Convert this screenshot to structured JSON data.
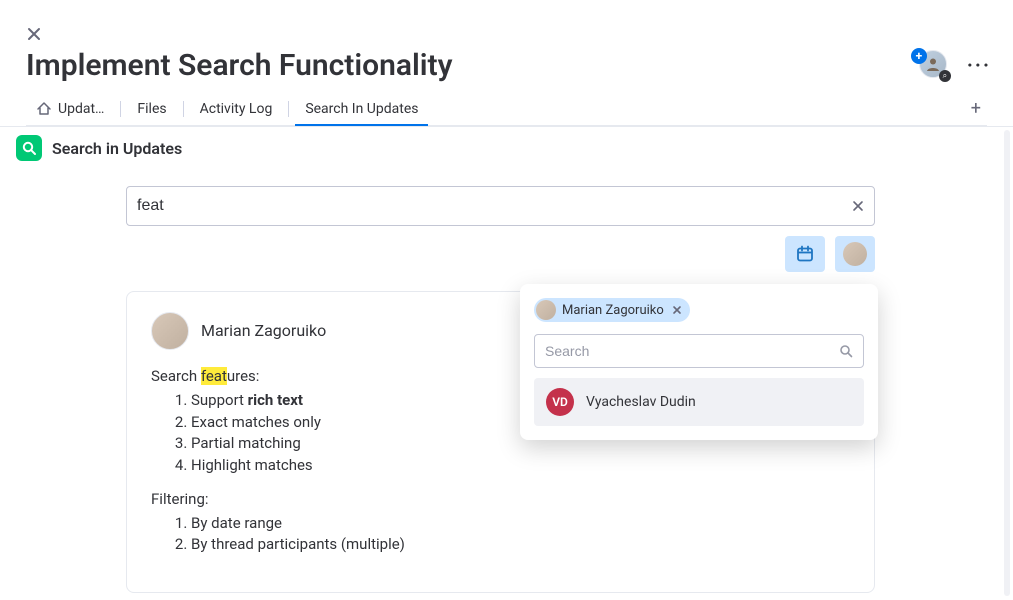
{
  "title": "Implement Search Functionality",
  "tabs": {
    "updates": "Updat…",
    "files": "Files",
    "activity_log": "Activity Log",
    "search_in_updates": "Search In Updates"
  },
  "subheader_title": "Search in Updates",
  "search_value": "feat",
  "update": {
    "author": "Marian Zagoruiko",
    "line1_pre": "Search ",
    "line1_hl": "feat",
    "line1_post": "ures:",
    "features": {
      "i1_pre": "Support ",
      "i1_bold": "rich text",
      "i2": "Exact matches only",
      "i3": "Partial matching",
      "i4": "Highlight matches"
    },
    "filtering_label": "Filtering:",
    "filtering": {
      "i1": "By date range",
      "i2": "By thread participants (multiple)"
    }
  },
  "popover": {
    "chip_name": "Marian Zagoruiko",
    "search_placeholder": "Search",
    "row_initials": "VD",
    "row_name": "Vyacheslav Dudin"
  }
}
